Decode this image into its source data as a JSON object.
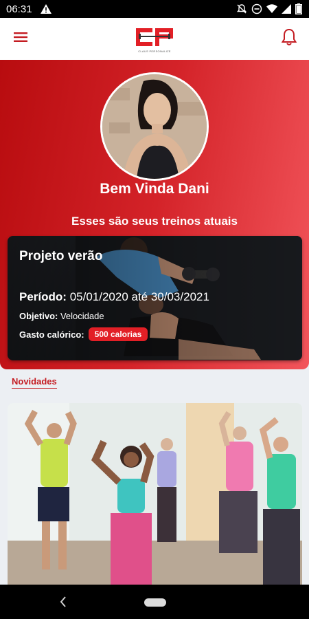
{
  "status_bar": {
    "time": "06:31"
  },
  "app_bar": {
    "logo_tagline": "CLAUS PERSONALIZE"
  },
  "hero": {
    "welcome": "Bem Vinda Dani",
    "subtitle": "Esses são seus treinos atuais"
  },
  "plan": {
    "title": "Projeto verão",
    "period_label": "Período:",
    "period_value": "05/01/2020 até 30/03/2021",
    "objective_label": "Objetivo:",
    "objective_value": "Velocidade",
    "calories_label": "Gasto calórico:",
    "calories_value": "500 calorias"
  },
  "news": {
    "label": "Novidades"
  },
  "colors": {
    "brand_red": "#d42329",
    "badge_red": "#e21f26"
  }
}
